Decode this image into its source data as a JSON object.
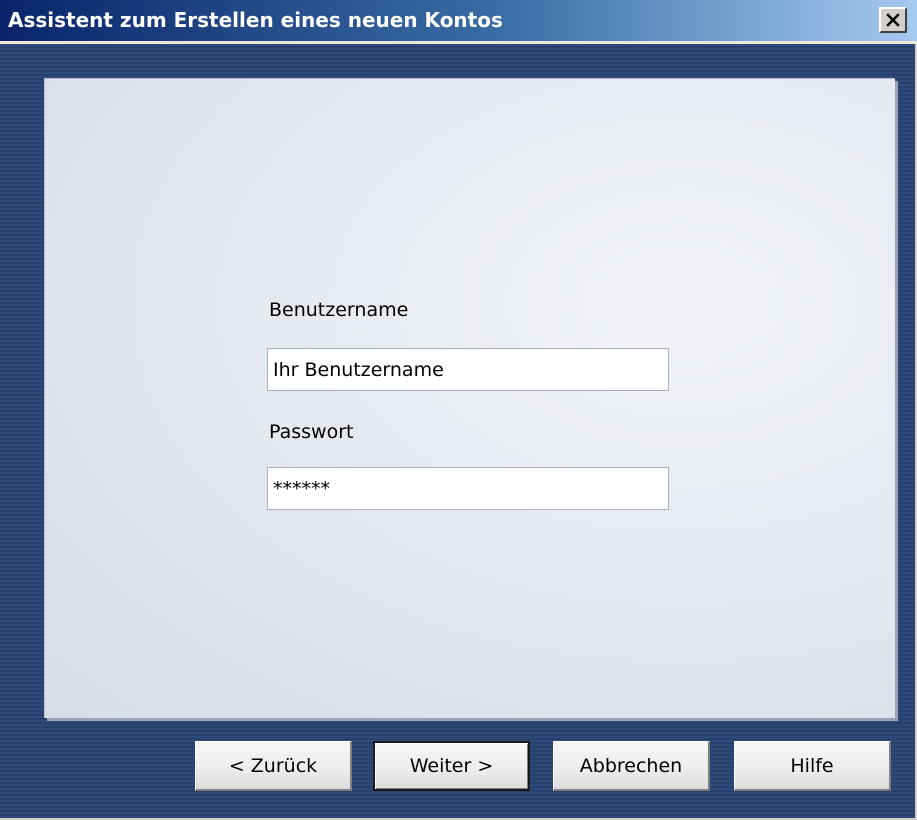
{
  "window": {
    "title": "Assistent zum Erstellen eines neuen Kontos",
    "close_icon": "close-icon"
  },
  "form": {
    "username_label": "Benutzername",
    "username_value": "Ihr Benutzername",
    "password_label": "Passwort",
    "password_value": "******"
  },
  "buttons": {
    "back_label": "< Zurück",
    "next_label": "Weiter >",
    "cancel_label": "Abbrechen",
    "help_label": "Hilfe"
  },
  "colors": {
    "title_gradient_start": "#0a246a",
    "title_gradient_end": "#a6caf0",
    "frame_background": "#2a4370",
    "panel_background": "#e3e7ee"
  }
}
